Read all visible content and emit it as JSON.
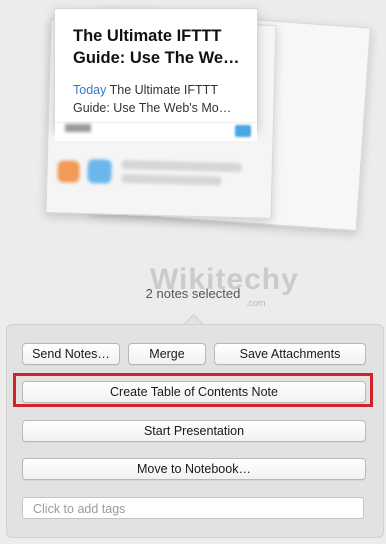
{
  "preview": {
    "title": "The Ultimate IFTTT Guide: Use The We…",
    "snippet_date": "Today",
    "snippet_text": " The Ultimate IFTTT Guide: Use The Web's Mo…"
  },
  "watermark": {
    "text": "Wikitechy",
    "sub": ".com"
  },
  "status": "2 notes selected",
  "actions": {
    "send_notes": "Send Notes…",
    "merge": "Merge",
    "save_attachments": "Save Attachments",
    "create_toc": "Create Table of Contents Note",
    "start_presentation": "Start Presentation",
    "move_to_notebook": "Move to Notebook…"
  },
  "tags": {
    "placeholder": "Click to add tags"
  },
  "colors": {
    "highlight_border": "#d2232a",
    "link_blue": "#2f7bd0"
  }
}
